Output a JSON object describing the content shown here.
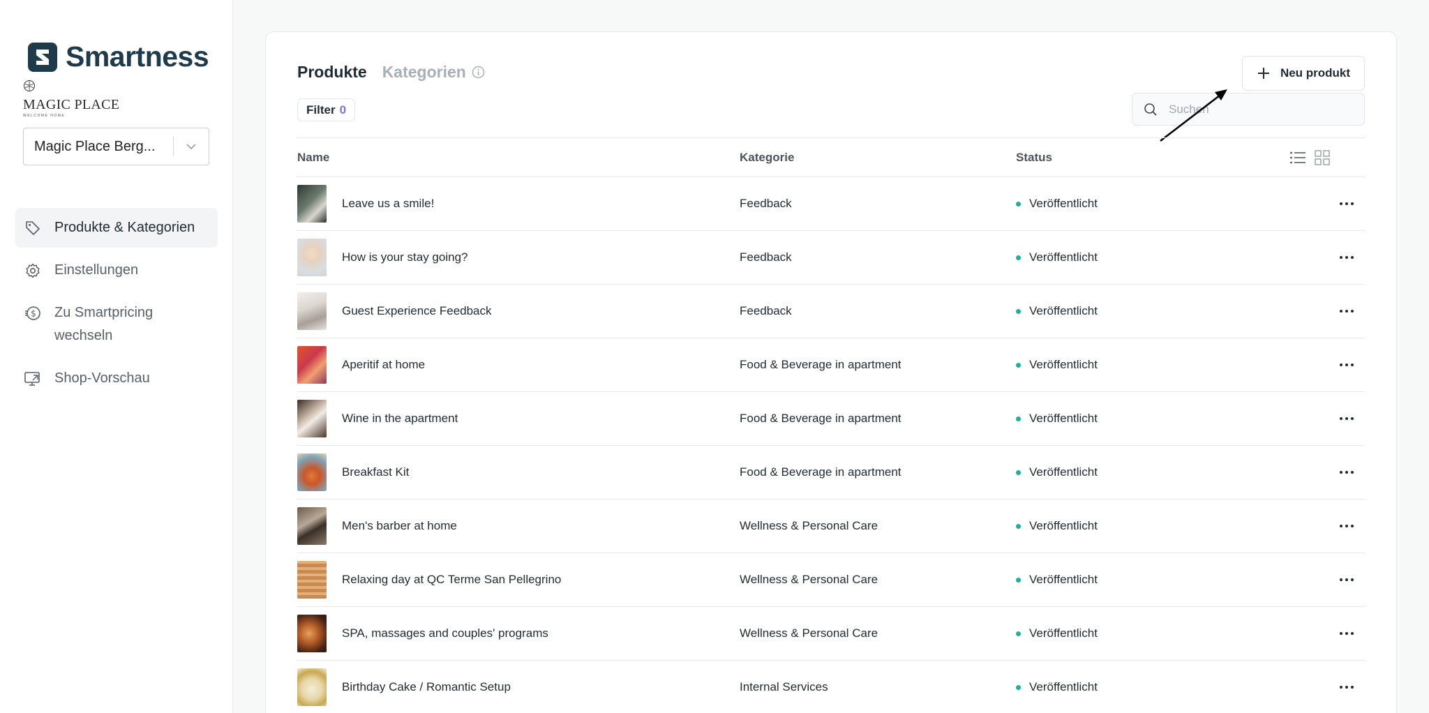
{
  "brand": {
    "name": "Smartness"
  },
  "client_logo": {
    "name": "MAGIC PLACE",
    "tagline": "WELCOME HOME"
  },
  "property_select": {
    "value": "Magic Place Berg..."
  },
  "nav": [
    {
      "label": "Produkte & Kategorien",
      "icon": "tag-icon",
      "active": true
    },
    {
      "label": "Einstellungen",
      "icon": "gear-icon",
      "active": false
    },
    {
      "label": "Zu Smartpricing wechseln",
      "icon": "dollar-cycle-icon",
      "active": false
    },
    {
      "label": "Shop-Vorschau",
      "icon": "monitor-icon",
      "active": false
    }
  ],
  "tabs": {
    "active": "Produkte",
    "other": "Kategorien"
  },
  "filter": {
    "label": "Filter",
    "count": "0"
  },
  "new_button": {
    "label": "Neu produkt"
  },
  "search": {
    "placeholder": "Suchen"
  },
  "table": {
    "headers": {
      "name": "Name",
      "category": "Kategorie",
      "status": "Status"
    },
    "rows": [
      {
        "name": "Leave us a smile!",
        "category": "Feedback",
        "status": "Veröffentlicht"
      },
      {
        "name": "How is your stay going?",
        "category": "Feedback",
        "status": "Veröffentlicht"
      },
      {
        "name": "Guest Experience Feedback",
        "category": "Feedback",
        "status": "Veröffentlicht"
      },
      {
        "name": "Aperitif at home",
        "category": "Food & Beverage in apartment",
        "status": "Veröffentlicht"
      },
      {
        "name": "Wine in the apartment",
        "category": "Food & Beverage in apartment",
        "status": "Veröffentlicht"
      },
      {
        "name": "Breakfast Kit",
        "category": "Food & Beverage in apartment",
        "status": "Veröffentlicht"
      },
      {
        "name": "Men's barber at home",
        "category": "Wellness & Personal Care",
        "status": "Veröffentlicht"
      },
      {
        "name": "Relaxing day at QC Terme San Pellegrino",
        "category": "Wellness & Personal Care",
        "status": "Veröffentlicht"
      },
      {
        "name": "SPA, massages and couples' programs",
        "category": "Wellness & Personal Care",
        "status": "Veröffentlicht"
      },
      {
        "name": "Birthday Cake / Romantic Setup",
        "category": "Internal Services",
        "status": "Veröffentlicht"
      }
    ]
  },
  "colors": {
    "brand": "#1f3a4a",
    "accent": "#7b6cf0",
    "status_published": "#1bb0a0"
  }
}
